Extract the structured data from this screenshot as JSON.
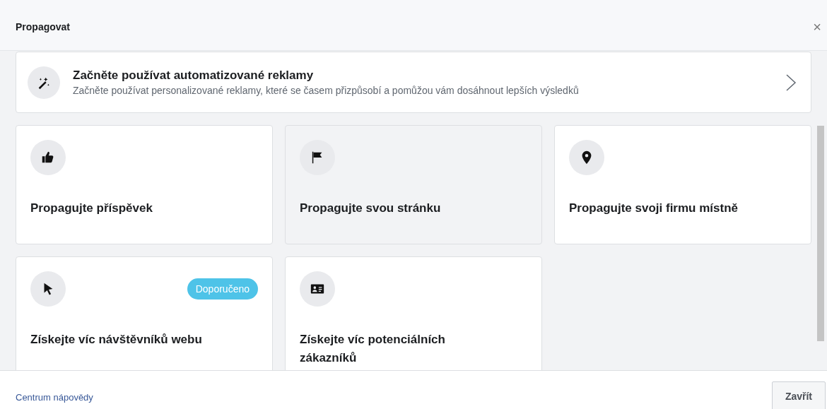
{
  "dialog": {
    "title": "Propagovat",
    "close_icon": "×"
  },
  "banner": {
    "title": "Začněte používat automatizované reklamy",
    "description": "Začněte používat personalizované reklamy, které se časem přizpůsobí a pomůžou vám dosáhnout lepších výsledků"
  },
  "options": [
    {
      "kind": "thumb",
      "title": "Propagujte příspěvek",
      "highlighted": false
    },
    {
      "kind": "flag",
      "title": "Propagujte svou stránku",
      "highlighted": true
    },
    {
      "kind": "pin",
      "title": "Propagujte svoji firmu místně",
      "highlighted": false
    },
    {
      "kind": "cursor",
      "title": "Získejte víc návštěvníků webu",
      "highlighted": false,
      "badge": "Doporučeno"
    },
    {
      "kind": "card",
      "title": "Získejte víc potenciálních zákazníků",
      "highlighted": false
    }
  ],
  "footer": {
    "help_link": "Centrum nápovědy",
    "close_button": "Zavřít"
  }
}
